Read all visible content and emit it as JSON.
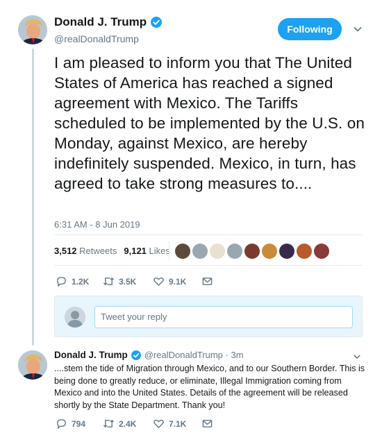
{
  "tweet": {
    "author_name": "Donald J. Trump",
    "handle": "@realDonaldTrump",
    "follow_label": "Following",
    "text": "I am pleased to inform you that The United States of America has reached a signed agreement with Mexico. The Tariffs scheduled to be implemented by the U.S. on Monday, against Mexico, are hereby indefinitely suspended. Mexico, in turn, has agreed to take strong measures to....",
    "timestamp": "6:31 AM - 8 Jun 2019",
    "retweets_count": "3,512",
    "retweets_label": "Retweets",
    "likes_count": "9,121",
    "likes_label": "Likes",
    "actions": {
      "replies": "1.2K",
      "retweets": "3.5K",
      "likes": "9.1K"
    }
  },
  "liker_avatars": [
    "#5c4a3a",
    "#9aa7b1",
    "#e8e0d0",
    "#9aa7b1",
    "#7a3b2e",
    "#c98a3a",
    "#3a2a4a",
    "#b85a2a",
    "#8a3a3a"
  ],
  "reply_box": {
    "placeholder": "Tweet your reply"
  },
  "reply": {
    "author_name": "Donald J. Trump",
    "handle_time": "@realDonaldTrump · 3m",
    "text": "....stem the tide of Migration through Mexico, and to our Southern Border. This is being done to greatly reduce, or eliminate, Illegal Immigration coming from Mexico and into the United States. Details of the agreement will be released shortly by the State Department. Thank you!",
    "actions": {
      "replies": "794",
      "retweets": "2.4K",
      "likes": "7.1K"
    }
  },
  "colors": {
    "accent": "#1da1f2",
    "text_secondary": "#657786"
  }
}
